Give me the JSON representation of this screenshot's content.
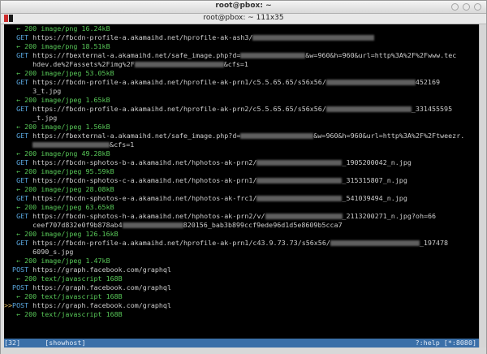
{
  "window": {
    "title": "root@pbox: ~"
  },
  "tab": {
    "title": "root@pbox: ~ 111x35"
  },
  "flows": [
    {
      "marker": "  ",
      "method": "",
      "text": "    ← 200 image/png 16.24kB",
      "kind": "resp"
    },
    {
      "marker": "  ",
      "method": "GET",
      "text": "https://fbcdn-profile-a.akamaihd.net/hprofile-ak-ash3/",
      "blur1": 150,
      "kind": "req"
    },
    {
      "marker": "  ",
      "method": "",
      "text": "    ← 200 image/png 18.51kB",
      "kind": "resp"
    },
    {
      "marker": "  ",
      "method": "GET",
      "text": "https://fbexternal-a.akamaihd.net/safe_image.php?d=",
      "blur1": 80,
      "tail": "&w=960&h=960&url=http%3A%2F%2Fwww.tec",
      "kind": "req"
    },
    {
      "marker": "  ",
      "method": "",
      "text": "    hdev.de%2Fassets%2Fimg%2F",
      "blur1": 110,
      "tail": "&cfs=1",
      "kind": "cont"
    },
    {
      "marker": "  ",
      "method": "",
      "text": "    ← 200 image/jpeg 53.05kB",
      "kind": "resp"
    },
    {
      "marker": "  ",
      "method": "GET",
      "text": "https://fbcdn-profile-a.akamaihd.net/hprofile-ak-prn1/c5.5.65.65/s56x56/",
      "blur1": 110,
      "tail": "452169",
      "kind": "req"
    },
    {
      "marker": "  ",
      "method": "",
      "text": "    3_t.jpg",
      "kind": "cont"
    },
    {
      "marker": "  ",
      "method": "",
      "text": "    ← 200 image/jpeg 1.65kB",
      "kind": "resp"
    },
    {
      "marker": "  ",
      "method": "GET",
      "text": "https://fbcdn-profile-a.akamaihd.net/hprofile-ak-prn2/c5.5.65.65/s56x56/",
      "blur1": 105,
      "tail": "_331455595",
      "kind": "req"
    },
    {
      "marker": "  ",
      "method": "",
      "text": "    _t.jpg",
      "kind": "cont"
    },
    {
      "marker": "  ",
      "method": "",
      "text": "    ← 200 image/jpeg 1.56kB",
      "kind": "resp"
    },
    {
      "marker": "  ",
      "method": "GET",
      "text": "https://fbexternal-a.akamaihd.net/safe_image.php?d=",
      "blur1": 90,
      "tail": "&w=960&h=960&url=http%3A%2F%2Ftweezr.",
      "kind": "req"
    },
    {
      "marker": "  ",
      "method": "",
      "text": "    ",
      "blur1": 95,
      "tail": "&cfs=1",
      "kind": "cont"
    },
    {
      "marker": "  ",
      "method": "",
      "text": "    ← 200 image/png 49.28kB",
      "kind": "resp"
    },
    {
      "marker": "  ",
      "method": "GET",
      "text": "https://fbcdn-sphotos-b-a.akamaihd.net/hphotos-ak-prn2/",
      "blur1": 105,
      "tail": "_1905200042_n.jpg",
      "kind": "req"
    },
    {
      "marker": "  ",
      "method": "",
      "text": "    ← 200 image/jpeg 95.59kB",
      "kind": "resp"
    },
    {
      "marker": "  ",
      "method": "GET",
      "text": "https://fbcdn-sphotos-c-a.akamaihd.net/hphotos-ak-prn1/",
      "blur1": 105,
      "tail": "_315315807_n.jpg",
      "kind": "req"
    },
    {
      "marker": "  ",
      "method": "",
      "text": "    ← 200 image/jpeg 28.08kB",
      "kind": "resp"
    },
    {
      "marker": "  ",
      "method": "GET",
      "text": "https://fbcdn-sphotos-e-a.akamaihd.net/hphotos-ak-frc1/",
      "blur1": 105,
      "tail": "_541039494_n.jpg",
      "kind": "req"
    },
    {
      "marker": "  ",
      "method": "",
      "text": "    ← 200 image/jpeg 63.65kB",
      "kind": "resp"
    },
    {
      "marker": "  ",
      "method": "GET",
      "text": "https://fbcdn-sphotos-h-a.akamaihd.net/hphotos-ak-prn2/v/",
      "blur1": 95,
      "tail": "_2113200271_n.jpg?oh=66",
      "kind": "req"
    },
    {
      "marker": "  ",
      "method": "",
      "text": "    ceef707d832e0f9b878ab4",
      "blur1": 75,
      "tail": "820156_bab3b899ccf9ede96d1d5e8609b5cca7",
      "kind": "cont"
    },
    {
      "marker": "  ",
      "method": "",
      "text": "    ← 200 image/jpeg 126.16kB",
      "kind": "resp"
    },
    {
      "marker": "  ",
      "method": "GET",
      "text": "https://fbcdn-profile-a.akamaihd.net/hprofile-ak-prn1/c43.9.73.73/s56x56/",
      "blur1": 110,
      "tail": "_197478",
      "kind": "req"
    },
    {
      "marker": "  ",
      "method": "",
      "text": "    6090_s.jpg",
      "kind": "cont"
    },
    {
      "marker": "  ",
      "method": "",
      "text": "    ← 200 image/jpeg 1.47kB",
      "kind": "resp"
    },
    {
      "marker": "  ",
      "method": "POST",
      "text": "https://graph.facebook.com/graphql",
      "kind": "req"
    },
    {
      "marker": "  ",
      "method": "",
      "text": "    ← 200 text/javascript 168B",
      "kind": "resp"
    },
    {
      "marker": "  ",
      "method": "POST",
      "text": "https://graph.facebook.com/graphql",
      "kind": "req"
    },
    {
      "marker": "  ",
      "method": "",
      "text": "    ← 200 text/javascript 168B",
      "kind": "resp"
    },
    {
      "marker": ">>",
      "method": "POST",
      "text": "https://graph.facebook.com/graphql",
      "kind": "req"
    },
    {
      "marker": "  ",
      "method": "",
      "text": "    ← 200 text/javascript 168B",
      "kind": "resp"
    }
  ],
  "status": {
    "left": "[32]      [showhost]",
    "right": "?:help [*:8080]"
  },
  "colors": {
    "terminal_bg": "#000000",
    "text": "#cdcdcd",
    "response": "#58c858",
    "method": "#5aa8e0",
    "focus_marker": "#e8c060",
    "statusbar": "#3a6fa8"
  }
}
